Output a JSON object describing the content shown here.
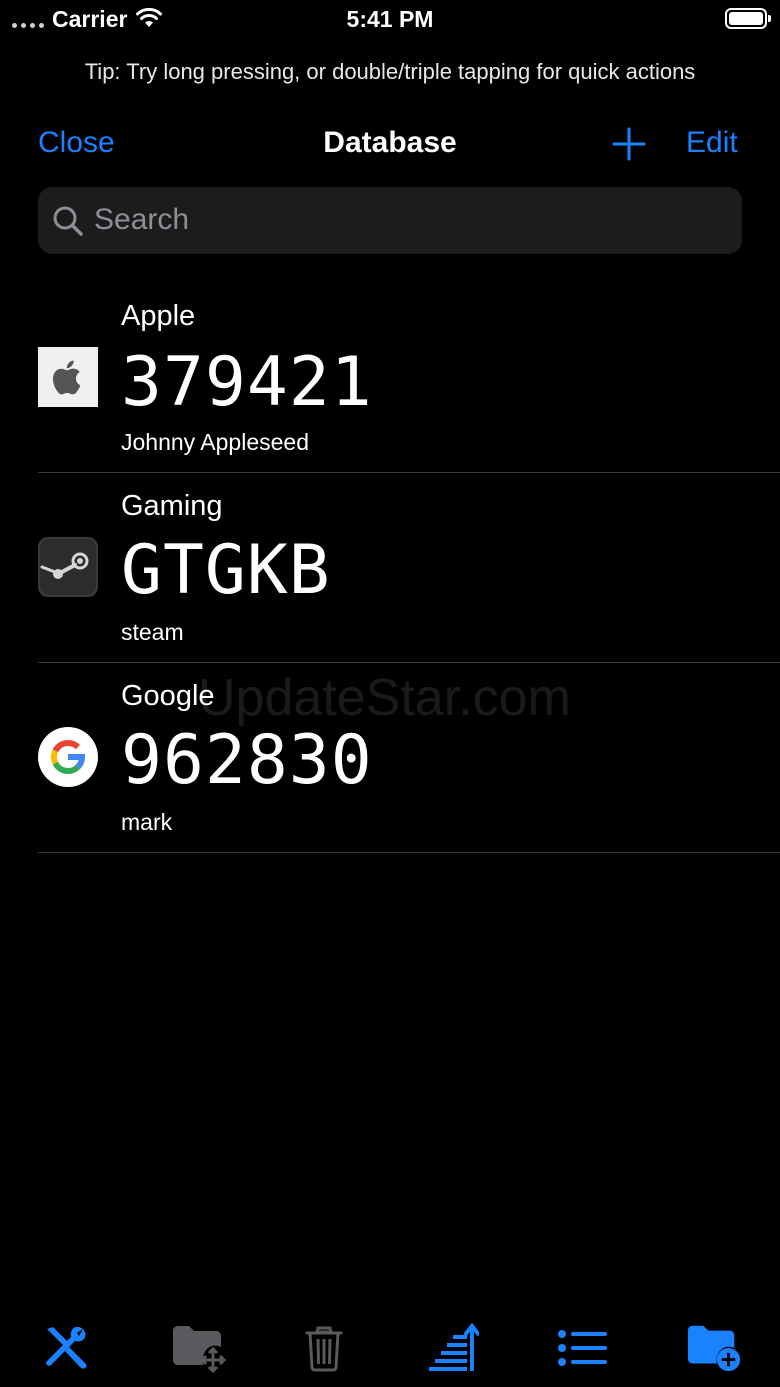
{
  "status_bar": {
    "carrier": "Carrier",
    "time": "5:41 PM"
  },
  "tip": "Tip: Try long pressing, or double/triple tapping for quick actions",
  "nav": {
    "close_label": "Close",
    "title": "Database",
    "edit_label": "Edit"
  },
  "search": {
    "placeholder": "Search"
  },
  "entries": [
    {
      "name": "Apple",
      "code": "379421",
      "account": "Johnny Appleseed",
      "icon": "apple-logo-icon"
    },
    {
      "name": "Gaming",
      "code": "GTGKB",
      "account": "steam",
      "icon": "steam-logo-icon"
    },
    {
      "name": "Google",
      "code": "962830",
      "account": "mark",
      "icon": "google-logo-icon"
    }
  ],
  "watermark": "UpdateStar.com",
  "toolbar": {
    "items": [
      "tools-icon",
      "move-to-folder-icon",
      "trash-icon",
      "sort-icon",
      "list-icon",
      "new-folder-icon"
    ]
  },
  "colors": {
    "accent": "#1a82ff",
    "background": "#000000",
    "search_bg": "#1c1c1e",
    "separator": "#38383a"
  }
}
